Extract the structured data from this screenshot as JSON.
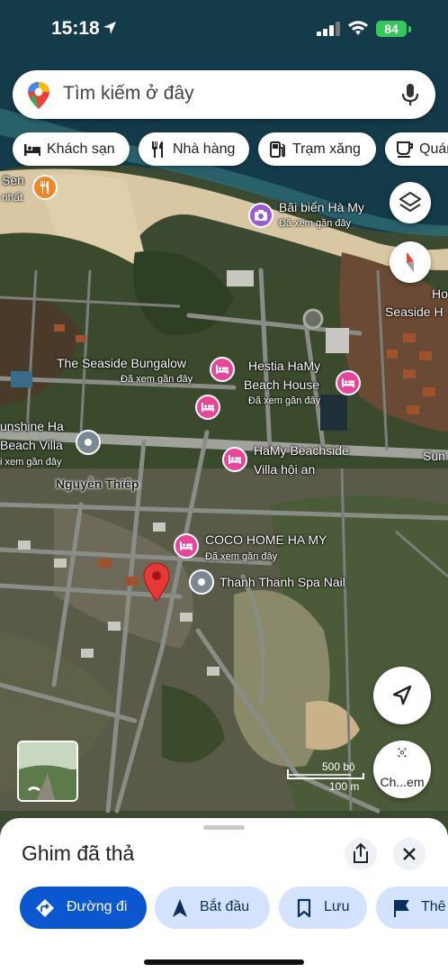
{
  "status_bar": {
    "time": "15:18",
    "battery": "84"
  },
  "search": {
    "placeholder": "Tìm kiếm ở đây"
  },
  "chips": [
    {
      "label": "Khách sạn",
      "icon": "bed-icon"
    },
    {
      "label": "Nhà hàng",
      "icon": "restaurant-icon"
    },
    {
      "label": "Trạm xăng",
      "icon": "gas-station-icon"
    },
    {
      "label": "Quán",
      "icon": "coffee-icon"
    }
  ],
  "map": {
    "places": [
      {
        "name": "Sen",
        "sub": "nhất"
      },
      {
        "name": "Bãi biển Hà My",
        "sub": "Đã xem gần đây"
      },
      {
        "name": "Ho",
        "sub": ""
      },
      {
        "name": "Seaside H",
        "sub": ""
      },
      {
        "name": "The Seaside Bungalow",
        "sub": "Đã xem gần đây"
      },
      {
        "name": "Hestia HaMy",
        "sub": ""
      },
      {
        "name": "Beach House",
        "sub": "Đã xem gần đây"
      },
      {
        "name": "unshine Ha",
        "sub": ""
      },
      {
        "name": "Beach Villa",
        "sub": "i xem gần đây"
      },
      {
        "name": "HaMy Beachside",
        "sub": ""
      },
      {
        "name": "Villa hội an",
        "sub": ""
      },
      {
        "name": "Sun",
        "sub": ""
      },
      {
        "name": "COCO HOME HA MY",
        "sub": "Đã xem gần đây"
      },
      {
        "name": "Thanh Thanh Spa Nail",
        "sub": ""
      }
    ],
    "street": "Nguyễn Thiếp",
    "scale": {
      "feet": "500 bộ",
      "meters": "100 m"
    },
    "street_view_label": "Ch...em",
    "colors": {
      "hotel_pin": "#e8459b",
      "photo_pin": "#9c5ad6",
      "food_pin": "#f0862a",
      "dropped_pin": "#e53935"
    }
  },
  "sheet": {
    "title": "Ghim đã thả",
    "actions": [
      {
        "label": "Đường đi",
        "icon": "directions-icon"
      },
      {
        "label": "Bắt đầu",
        "icon": "navigation-arrow-icon"
      },
      {
        "label": "Lưu",
        "icon": "bookmark-icon"
      },
      {
        "label": "Thê",
        "icon": "flag-icon"
      }
    ],
    "colors": {
      "primary_action_bg": "#0b57d0",
      "secondary_action_bg": "#d3e3fd"
    }
  }
}
